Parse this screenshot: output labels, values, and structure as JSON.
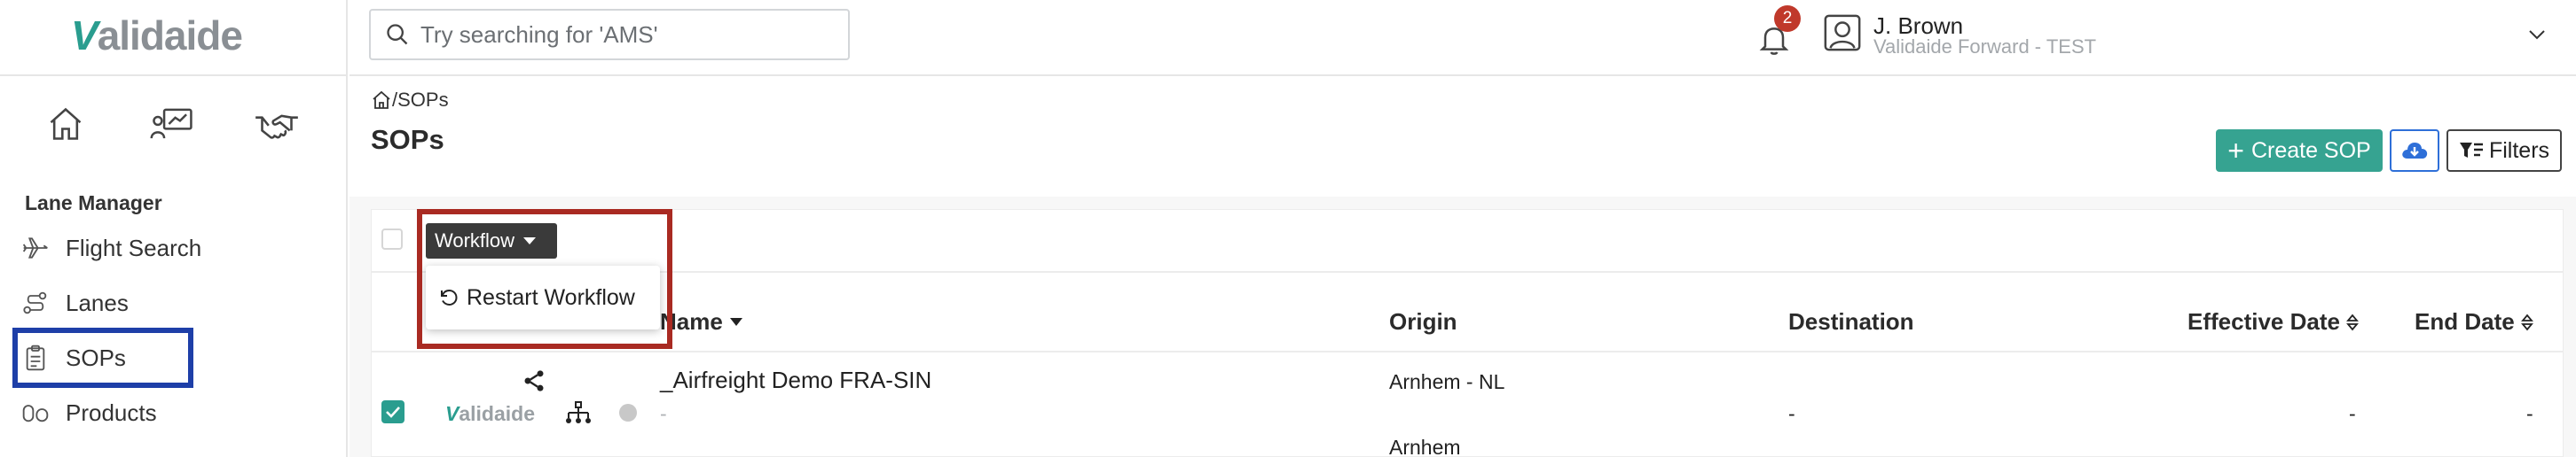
{
  "app": {
    "logo_text": "Validaide",
    "accent": "#2a9d8f"
  },
  "search": {
    "placeholder": "Try searching for 'AMS'",
    "icon": "search-icon"
  },
  "notifications": {
    "count": "2",
    "icon": "bell-icon"
  },
  "user": {
    "name": "J. Brown",
    "org": "Validaide Forward - TEST",
    "icon": "user-icon"
  },
  "sidebar": {
    "top_icons": [
      "home-icon",
      "analytics-icon",
      "handshake-icon"
    ],
    "section_title": "Lane Manager",
    "items": [
      {
        "label": "Flight Search",
        "icon": "airplane-icon"
      },
      {
        "label": "Lanes",
        "icon": "route-icon"
      },
      {
        "label": "SOPs",
        "icon": "clipboard-icon",
        "active": true
      },
      {
        "label": "Products",
        "icon": "products-icon"
      }
    ]
  },
  "breadcrumb": {
    "path": "/SOPs"
  },
  "page": {
    "title": "SOPs"
  },
  "toolbar": {
    "create_label": "Create SOP",
    "create_color": "#36a391",
    "filters_label": "Filters"
  },
  "bulk": {
    "workflow_label": "Workflow",
    "menu": [
      {
        "label": "Restart Workflow",
        "icon": "restart-icon"
      }
    ]
  },
  "table": {
    "headers": {
      "name": "Name",
      "origin": "Origin",
      "destination": "Destination",
      "effective_date": "Effective Date",
      "end_date": "End Date"
    },
    "rows": [
      {
        "checked": true,
        "company_logo": "Validaide",
        "name": "_Airfreight Demo FRA-SIN",
        "subtitle": "-",
        "origin_1": "Arnhem - NL",
        "origin_2": "Arnhem",
        "destination": "-",
        "effective_date": "-",
        "end_date": "-"
      }
    ]
  }
}
